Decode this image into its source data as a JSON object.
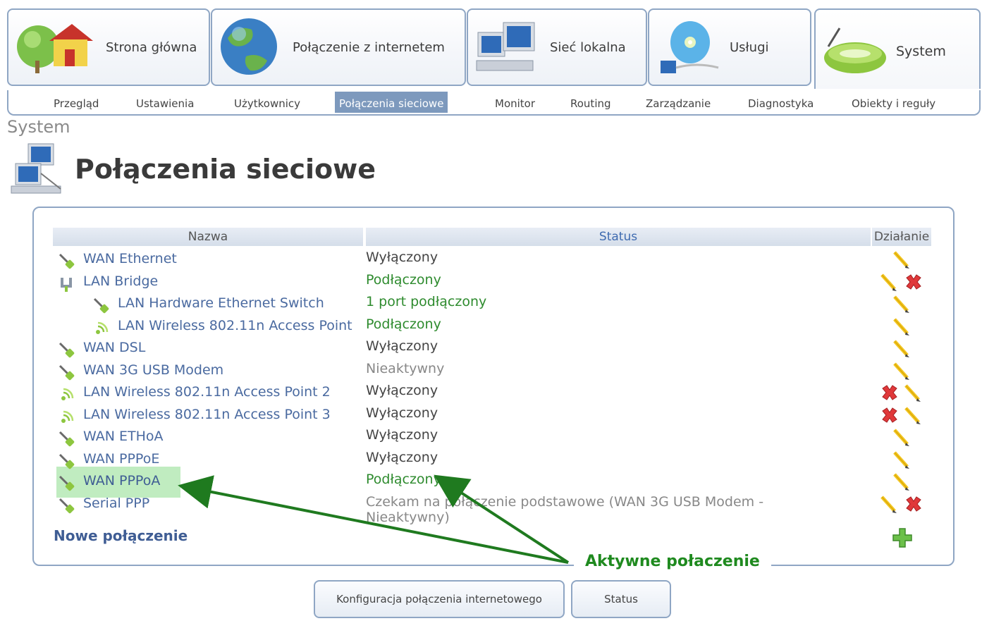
{
  "top_tabs": [
    {
      "label": "Strona główna",
      "icon": "home-icon"
    },
    {
      "label": "Połączenie z internetem",
      "icon": "globe-icon"
    },
    {
      "label": "Sieć lokalna",
      "icon": "network-computers-icon"
    },
    {
      "label": "Usługi",
      "icon": "services-disc-icon"
    },
    {
      "label": "System",
      "icon": "system-router-icon",
      "active": true
    }
  ],
  "sub_nav": [
    "Przegląd",
    "Ustawienia",
    "Użytkownicy",
    "Połączenia sieciowe",
    "Monitor",
    "Routing",
    "Zarządzanie",
    "Diagnostyka",
    "Obiekty i reguły"
  ],
  "sub_nav_active": "Połączenia sieciowe",
  "breadcrumb": "System",
  "page_title": "Połączenia sieciowe",
  "table": {
    "headers": {
      "name": "Nazwa",
      "status": "Status",
      "action": "Działanie"
    },
    "rows": [
      {
        "name": "WAN Ethernet",
        "status": "Wyłączony",
        "state": "off",
        "icon": "ethernet-cable-icon",
        "indent": 0,
        "actions": [
          "edit"
        ]
      },
      {
        "name": "LAN Bridge",
        "status": "Podłączony",
        "state": "on",
        "icon": "bridge-icon",
        "indent": 0,
        "actions": [
          "edit",
          "delete"
        ]
      },
      {
        "name": "LAN Hardware Ethernet Switch",
        "status": "1 port podłączony",
        "state": "on",
        "icon": "ethernet-cable-icon",
        "indent": 1,
        "actions": [
          "edit"
        ]
      },
      {
        "name": "LAN Wireless 802.11n Access Point",
        "status": "Podłączony",
        "state": "on",
        "icon": "wireless-icon",
        "indent": 1,
        "actions": [
          "edit"
        ]
      },
      {
        "name": "WAN DSL",
        "status": "Wyłączony",
        "state": "off",
        "icon": "ethernet-cable-icon",
        "indent": 0,
        "actions": [
          "edit"
        ]
      },
      {
        "name": "WAN 3G USB Modem",
        "status": "Nieaktywny",
        "state": "inactive",
        "icon": "ethernet-cable-icon",
        "indent": 0,
        "actions": [
          "edit"
        ]
      },
      {
        "name": "LAN Wireless 802.11n Access Point 2",
        "status": "Wyłączony",
        "state": "off",
        "icon": "wireless-icon",
        "indent": 0,
        "actions": [
          "delete",
          "edit"
        ]
      },
      {
        "name": "LAN Wireless 802.11n Access Point 3",
        "status": "Wyłączony",
        "state": "off",
        "icon": "wireless-icon",
        "indent": 0,
        "actions": [
          "delete",
          "edit"
        ]
      },
      {
        "name": "WAN ETHoA",
        "status": "Wyłączony",
        "state": "off",
        "icon": "ethernet-cable-icon",
        "indent": 0,
        "actions": [
          "edit"
        ]
      },
      {
        "name": "WAN PPPoE",
        "status": "Wyłączony",
        "state": "off",
        "icon": "ethernet-cable-icon",
        "indent": 0,
        "actions": [
          "edit"
        ]
      },
      {
        "name": "WAN PPPoA",
        "status": "Podłączony",
        "state": "on",
        "icon": "ethernet-cable-icon",
        "indent": 0,
        "actions": [
          "edit"
        ],
        "highlighted": true
      },
      {
        "name": "Serial PPP",
        "status": "Czekam na połączenie podstawowe (WAN 3G USB Modem -\nNieaktywny)",
        "state": "inactive",
        "icon": "ethernet-cable-icon",
        "indent": 0,
        "actions": [
          "edit",
          "delete"
        ]
      }
    ]
  },
  "new_connection_label": "Nowe połączenie",
  "annotation": "Aktywne połaczenie",
  "buttons": {
    "config": "Konfiguracja połączenia internetowego",
    "status": "Status"
  },
  "colors": {
    "border": "#8fa6c4",
    "link": "#4a6aa0",
    "connected": "#2e8b2e",
    "annotation": "#1f8a1f",
    "active_tab_bg": "#7d99bd"
  }
}
